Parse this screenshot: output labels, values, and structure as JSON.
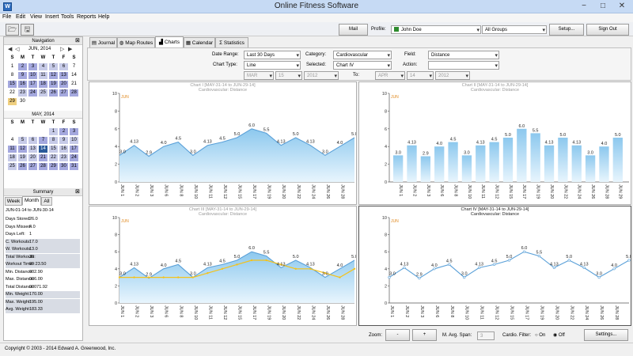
{
  "window": {
    "title": "Online Fitness Software"
  },
  "menu": [
    "File",
    "Edit",
    "View",
    "Insert",
    "Tools",
    "Reports",
    "Help"
  ],
  "header": {
    "mail_label": "Mail",
    "profile_label": "Profile:",
    "profile_value": "John Doe",
    "group_value": "All Groups",
    "setup_label": "Setup...",
    "signout_label": "Sign Out"
  },
  "navigation": {
    "title": "Navigation",
    "dows": [
      "S",
      "M",
      "T",
      "W",
      "T",
      "F",
      "S"
    ],
    "june": {
      "label": "JUN, 2014",
      "rows": [
        [
          "1",
          "2",
          "3",
          "4",
          "5",
          "6",
          "7"
        ],
        [
          "8",
          "9",
          "10",
          "11",
          "12",
          "13",
          "14"
        ],
        [
          "15",
          "16",
          "17",
          "18",
          "19",
          "20",
          "21"
        ],
        [
          "22",
          "23",
          "24",
          "25",
          "26",
          "27",
          "28"
        ],
        [
          "29",
          "30",
          "",
          "",
          "",
          "",
          ""
        ]
      ]
    },
    "may": {
      "label": "MAY, 2014",
      "rows": [
        [
          "",
          "",
          "",
          "",
          "1",
          "2",
          "3"
        ],
        [
          "4",
          "5",
          "6",
          "7",
          "8",
          "9",
          "10"
        ],
        [
          "11",
          "12",
          "13",
          "14",
          "15",
          "16",
          "17"
        ],
        [
          "18",
          "19",
          "20",
          "21",
          "22",
          "23",
          "24"
        ],
        [
          "25",
          "26",
          "27",
          "28",
          "29",
          "30",
          "31"
        ]
      ]
    }
  },
  "summary": {
    "title": "Summary",
    "tabs": [
      "Week",
      "Month",
      "All"
    ],
    "range": "JUN-01-14 to JUN-30-14",
    "rows": [
      {
        "label": "Days Stored:",
        "value": "26.0"
      },
      {
        "label": "Days Missed:",
        "value": "4.0"
      },
      {
        "label": "Days Left:",
        "value": "1"
      },
      {
        "label": "C. Workouts:",
        "value": "17.0"
      },
      {
        "label": "W. Workouts:",
        "value": "13.0"
      },
      {
        "label": "Total Workouts:",
        "value": "30"
      },
      {
        "label": "Workout Time:",
        "value": "09:23.50"
      },
      {
        "label": "Min. Distance:",
        "value": "002.90"
      },
      {
        "label": "Max. Distance:",
        "value": "006.00"
      },
      {
        "label": "Total Distance:",
        "value": "00071.92"
      },
      {
        "label": "Min. Weight:",
        "value": "170.00"
      },
      {
        "label": "Max. Weight:",
        "value": "195.00"
      },
      {
        "label": "Avg. Weight:",
        "value": "183.33"
      }
    ]
  },
  "tabs": [
    "Journal",
    "Map Routes",
    "Charts",
    "Calendar",
    "Statistics"
  ],
  "filters": {
    "date_range_label": "Date Range:",
    "date_range": "Last 30 Days",
    "category_label": "Category:",
    "category": "Cardiovascular",
    "field_label": "Field:",
    "field": "Distance",
    "chart_type_label": "Chart Type:",
    "chart_type": "Line",
    "selected_label": "Selected:",
    "selected": "Chart IV",
    "action_label": "Action:",
    "action": "",
    "from_month": "MAR",
    "from_day": "15",
    "from_year": "2012",
    "to_label": "To:",
    "to_month": "APR",
    "to_day": "14",
    "to_year": "2012"
  },
  "charts": [
    {
      "title": "Chart I [MAY-31-14 to JUN-29-14]",
      "subtitle": "Cardiovascular:  Distance",
      "legend": "JUN"
    },
    {
      "title": "Chart II [MAY-31-14 to JUN-29-14]",
      "subtitle": "Cardiovascular:  Distance",
      "legend": "JUN"
    },
    {
      "title": "Chart III [MAY-31-14 to JUN-29-14]",
      "subtitle": "Cardiovascular:  Distance",
      "legend": "JUN"
    },
    {
      "title": "Chart IV [MAY-31-14 to JUN-29-14]",
      "subtitle": "Cardiovascular:  Distance",
      "legend": "JUN"
    }
  ],
  "chart_data": [
    {
      "type": "area",
      "title": "Chart I [MAY-31-14 to JUN-29-14]",
      "subtitle": "Cardiovascular:  Distance",
      "ylim": [
        0,
        10
      ],
      "yticks": [
        0,
        2,
        4,
        6,
        8,
        10
      ],
      "x": [
        "JUN 1",
        "JUN 2",
        "JUN 3",
        "JUN 6",
        "JUN 8",
        "JUN 10",
        "JUN 11",
        "JUN 12",
        "JUN 15",
        "JUN 17",
        "JUN 19",
        "JUN 20",
        "JUN 22",
        "JUN 24",
        "JUN 26",
        "JUN 28",
        "JUN 29"
      ],
      "values": [
        3.0,
        4.13,
        2.9,
        4.0,
        4.5,
        3.0,
        4.13,
        4.5,
        5.0,
        6.0,
        5.5,
        4.13,
        5.0,
        4.13,
        3.0,
        4.0,
        5.0
      ],
      "legend": [
        "JUN"
      ]
    },
    {
      "type": "bar",
      "title": "Chart II [MAY-31-14 to JUN-29-14]",
      "subtitle": "Cardiovascular:  Distance",
      "ylim": [
        0,
        10
      ],
      "yticks": [
        0,
        2,
        4,
        6,
        8,
        10
      ],
      "x": [
        "JUN 1",
        "JUN 2",
        "JUN 3",
        "JUN 6",
        "JUN 8",
        "JUN 10",
        "JUN 11",
        "JUN 12",
        "JUN 15",
        "JUN 17",
        "JUN 19",
        "JUN 20",
        "JUN 22",
        "JUN 24",
        "JUN 26",
        "JUN 28",
        "JUN 29"
      ],
      "values": [
        3.0,
        4.13,
        2.9,
        4.0,
        4.5,
        3.0,
        4.13,
        4.5,
        5.0,
        6.0,
        5.5,
        4.13,
        5.0,
        4.13,
        3.0,
        4.0,
        5.0
      ],
      "legend": [
        "JUN"
      ]
    },
    {
      "type": "area",
      "title": "Chart III [MAY-31-14 to JUN-29-14]",
      "subtitle": "Cardiovascular:  Distance",
      "ylim": [
        0,
        10
      ],
      "yticks": [
        0,
        2,
        4,
        6,
        8,
        10
      ],
      "x": [
        "JUN 1",
        "JUN 2",
        "JUN 3",
        "JUN 6",
        "JUN 8",
        "JUN 10",
        "JUN 11",
        "JUN 12",
        "JUN 15",
        "JUN 17",
        "JUN 19",
        "JUN 20",
        "JUN 22",
        "JUN 24",
        "JUN 26",
        "JUN 28",
        "JUN 29"
      ],
      "values": [
        3.0,
        4.13,
        2.9,
        4.0,
        4.5,
        3.0,
        4.13,
        4.5,
        5.0,
        6.0,
        5.5,
        4.13,
        5.0,
        4.13,
        3.0,
        4.0,
        5.0
      ],
      "avg_values": [
        3.0,
        3.0,
        3.0,
        3.0,
        3.0,
        3.0,
        3.5,
        4.0,
        4.5,
        5.0,
        5.0,
        4.5,
        4.0,
        4.0,
        3.5,
        3.0,
        4.0
      ],
      "legend": [
        "JUN"
      ]
    },
    {
      "type": "line",
      "title": "Chart IV [MAY-31-14 to JUN-29-14]",
      "subtitle": "Cardiovascular:  Distance",
      "ylim": [
        0,
        10
      ],
      "yticks": [
        0,
        2,
        4,
        6,
        8,
        10
      ],
      "x": [
        "JUN 1",
        "JUN 2",
        "JUN 3",
        "JUN 6",
        "JUN 8",
        "JUN 10",
        "JUN 11",
        "JUN 12",
        "JUN 15",
        "JUN 17",
        "JUN 19",
        "JUN 20",
        "JUN 22",
        "JUN 24",
        "JUN 26",
        "JUN 28",
        "JUN 29"
      ],
      "values": [
        3.0,
        4.13,
        2.9,
        4.0,
        4.5,
        3.0,
        4.13,
        4.5,
        5.0,
        6.0,
        5.5,
        4.13,
        5.0,
        4.13,
        3.0,
        4.0,
        5.0
      ],
      "legend": [
        "JUN"
      ]
    }
  ],
  "bottom": {
    "zoom_label": "Zoom:",
    "zoom_out": "-",
    "zoom_in": "+",
    "mavg_label": "M. Avg. Span:",
    "mavg_value": "3",
    "cardio_label": "Cardio. Filter:",
    "on_label": "On",
    "off_label": "Off",
    "settings_label": "Settings..."
  },
  "status": "Copyright © 2003 - 2014 Edward A. Greenwood, Inc.",
  "colors": {
    "accent": "#2a5a9a",
    "fill": "#9fd0f0",
    "line": "#5aa0d8",
    "avg": "#f4c21a",
    "profile": "#2e8b2e"
  }
}
